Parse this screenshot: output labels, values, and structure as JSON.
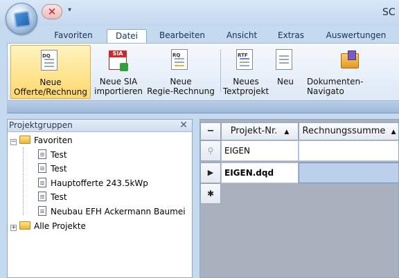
{
  "app": {
    "title_partial": "SC"
  },
  "qat": {
    "close_glyph": "✕",
    "dropdown_glyph": "▾"
  },
  "tabs": [
    {
      "label": "Favoriten",
      "active": false
    },
    {
      "label": "Datei",
      "active": true
    },
    {
      "label": "Bearbeiten",
      "active": false
    },
    {
      "label": "Ansicht",
      "active": false
    },
    {
      "label": "Extras",
      "active": false
    },
    {
      "label": "Auswertungen",
      "active": false
    }
  ],
  "ribbon": {
    "new_offer": {
      "line1": "Neue",
      "line2": "Offerte/Rechnung",
      "icon_tag": "DQ"
    },
    "import_sia": {
      "line1": "Neue SIA",
      "line2": "importieren",
      "icon_tag": "SIA"
    },
    "new_regie": {
      "line1": "Neue",
      "line2": "Regie-Rechnung",
      "icon_tag": "RQ"
    },
    "new_text": {
      "line1": "Neues",
      "line2": "Textprojekt",
      "icon_tag": "RTF"
    },
    "new": {
      "line1": "Neu"
    },
    "doc_nav": {
      "line1": "Dokumenten-Navigato"
    }
  },
  "left_panel": {
    "title": "Projektgruppen",
    "close_glyph": "✕",
    "tree": {
      "favorites_label": "Favoriten",
      "favorites_expander": "−",
      "items": [
        "Test",
        "Test",
        "Hauptofferte 243.5kWp",
        "Test",
        "Neubau EFH Ackermann Baumei"
      ],
      "all_projects_label": "Alle Projekte",
      "all_projects_expander": "+"
    }
  },
  "grid": {
    "corner_glyph": "−",
    "columns": [
      {
        "label": "Projekt-Nr.",
        "sort": "▲"
      },
      {
        "label": "Rechnungssumme",
        "sort": "▲"
      }
    ],
    "filter_row": {
      "indicator": "⚲",
      "project": "EIGEN",
      "sum": ""
    },
    "rows": [
      {
        "indicator": "▶",
        "project": "EIGEN.dqd",
        "sum": ""
      }
    ],
    "new_row_indicator": "✱"
  },
  "colors": {
    "ribbon_hot": "#ffd86a",
    "selected_cell": "#bcd0ec",
    "grid_bg": "#a8b1bd"
  }
}
